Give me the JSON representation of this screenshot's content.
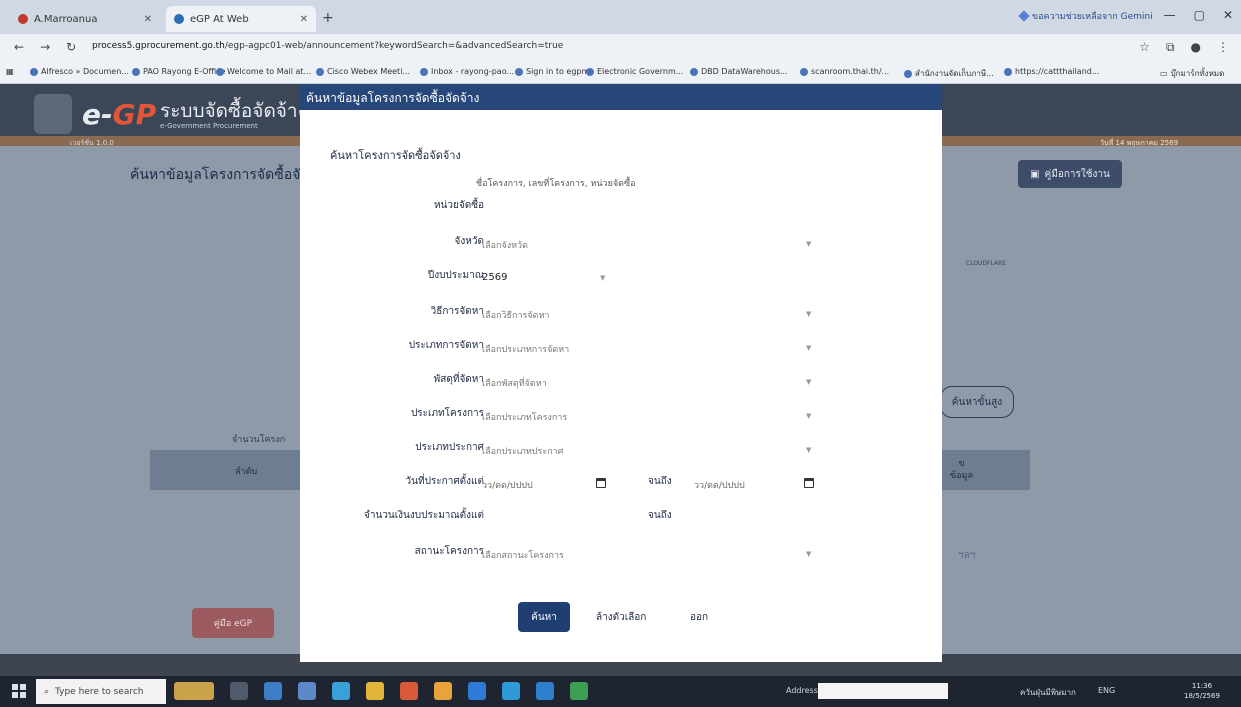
{
  "browser": {
    "tabs": [
      {
        "label": "A.Marroanua"
      },
      {
        "label": "eGP At Web"
      }
    ],
    "new_tab": "+",
    "gemini": "ขอความช่วยเหลือจาก Gemini",
    "url_host": "process5.gprocurement.go.th",
    "url_path": "/egp-agpc01-web/announcement?keywordSearch=&advancedSearch=true",
    "bookmarks": [
      "Alfresco » Documen...",
      "PAO Rayong E-Office",
      "Welcome to Mail at...",
      "Cisco Webex Meeti...",
      "Inbox - rayong-pao...",
      "Sign in to egpms",
      "Electronic Governm...",
      "DBD DataWarehous...",
      "scanroom.thai.th/...",
      "สำนักงานจัดเก็บภาษี...",
      "https://cattthailand..."
    ],
    "all_bookmarks": "บุ๊กมาร์กทั้งหมด"
  },
  "page": {
    "site_name": "ระบบจัดซื้อจัดจ้างภา",
    "site_sub": "e-Government Procurement",
    "logo_e": "e-",
    "logo_gp": "GP",
    "version": "เวอร์ชั่น 1.0.0",
    "date": "วันที่ 14 พฤษภาคม 2569",
    "title": "ค้นหาข้อมูลโครงการจัดซื้อจัดจ้า",
    "my_button": "คู่มือการใช้งาน",
    "cloudflare": "CLOUDFLARE",
    "advanced_search": "ค้นหาขั้นสูง",
    "count_label": "จำนวนโครงก",
    "col_order": "ลำดับ",
    "col_info_1": "ข",
    "col_info_2": "ข้อมูล",
    "etc": "ฯลฯ",
    "manual": "คู่มือ eGP"
  },
  "modal": {
    "header": "ค้นหาข้อมูลโครงการจัดซื้อจัดจ้าง",
    "section_title": "ค้นหาโครงการจัดซื้อจัดจ้าง",
    "keyword_hint": "ชื่อโครงการ, เลขที่โครงการ, หน่วยจัดซื้อ",
    "labels": {
      "agency": "หน่วยจัดซื้อ",
      "province": "จังหวัด",
      "budget_year": "ปีงบประมาณ",
      "method": "วิธีการจัดหา",
      "procurement_type": "ประเภทการจัดหา",
      "supply": "พัสดุที่จัดหา",
      "project_type": "ประเภทโครงการ",
      "announcement_type": "ประเภทประกาศ",
      "announce_from": "วันที่ประกาศตั้งแต่",
      "budget_from": "จำนวนเงินงบประมาณตั้งแต่",
      "status": "สถานะโครงการ",
      "to": "จนถึง"
    },
    "placeholders": {
      "province": "เลือกจังหวัด",
      "method": "เลือกวิธีการจัดหา",
      "procurement_type": "เลือกประเภทการจัดหา",
      "supply": "เลือกพัสดุที่จัดหา",
      "project_type": "เลือกประเภทโครงการ",
      "announcement_type": "เลือกประเภทประกาศ",
      "date": "วว/ดด/ปปปป",
      "status": "เลือกสถานะโครงการ"
    },
    "budget_year_value": "2569",
    "buttons": {
      "search": "ค้นหา",
      "clear": "ล้างตัวเลือก",
      "exit": "ออก"
    }
  },
  "taskbar": {
    "search_placeholder": "Type here to search",
    "address_label": "Address",
    "weather": "ควันฝุ่นมีพิษมาก",
    "lang": "ENG",
    "time": "11:36",
    "date": "18/5/2569"
  }
}
